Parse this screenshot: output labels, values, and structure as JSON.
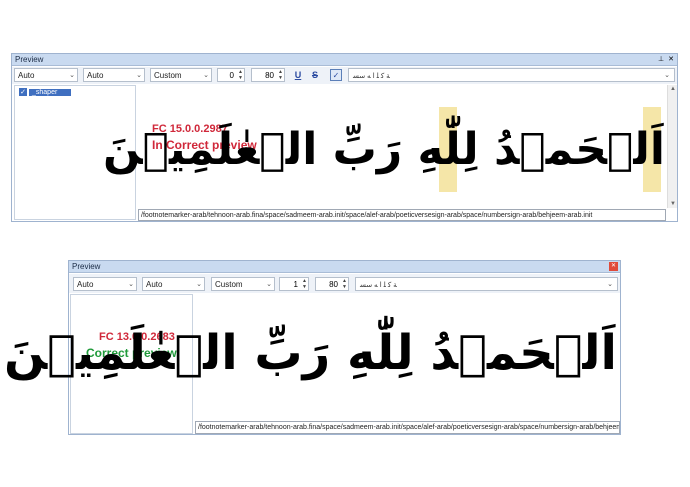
{
  "top_window": {
    "title": "Preview",
    "toolbar": {
      "combo1": "Auto",
      "combo2": "Auto",
      "combo3": "Custom",
      "spin1": "0",
      "spin2": "80",
      "underline_label": "U",
      "strike_label": "S",
      "checkbox_glyph": "✓",
      "sample_text": "ﺔ ﮐ ﻠ ﺍ ﻪ ﺳﺴ"
    },
    "shaper_label": "_shaper",
    "version": "FC 15.0.0.2987",
    "status": "In Correct preview",
    "arabic_text": "اَلۡحَمۡدُ لِلّٰهِ رَبِّ الۡعٰلَمِيۡنَ",
    "glyph_path": "/footnotemarker-arab/tehnoon-arab.fina/space/sadmeem-arab.init/space/alef-arab/poeticversesign-arab/space/numbersign-arab/behjeem-arab.init",
    "pin_icon": "📌",
    "close_icon": "✕"
  },
  "bottom_window": {
    "title": "Preview",
    "toolbar": {
      "combo1": "Auto",
      "combo2": "Auto",
      "combo3": "Custom",
      "spin1": "1",
      "spin2": "80",
      "sample_text": "ﺔ ﮐ ﻠ ﺍ ﻪ ﺳﺴ"
    },
    "version": "FC 13.0.0.2683",
    "status": "Correct preview",
    "arabic_text": "اَلۡحَمۡدُ لِلّٰهِ رَبِّ الۡعٰلَمِيۡنَ",
    "glyph_path": "/footnotemarker-arab/tehnoon-arab.fina/space/sadmeem-arab.init/space/alef-arab/poeticversesign-arab/space/numbersign-arab/behjeem-arab.init",
    "close_icon": "✕"
  },
  "colors": {
    "version_red": "#d0283a",
    "status_red": "#d0283a",
    "status_green": "#1f9a3a",
    "highlight": "#eed66e"
  }
}
